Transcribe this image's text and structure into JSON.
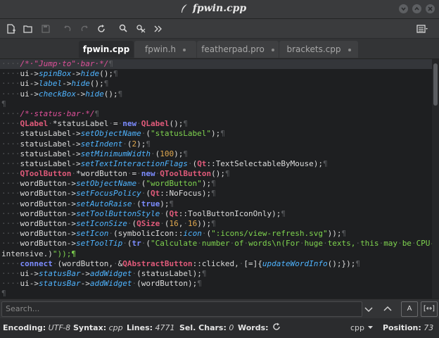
{
  "window": {
    "title": "fpwin.cpp",
    "buttons": [
      "minimize",
      "maximize",
      "close"
    ]
  },
  "toolbar": {
    "items": [
      "new-file-icon",
      "open-folder-icon",
      "save-icon",
      "undo-icon",
      "redo-icon",
      "reload-icon",
      "find-icon",
      "find-replace-icon",
      "go-to-line-icon",
      "menu-icon"
    ]
  },
  "tabs": [
    {
      "label": "fpwin.cpp",
      "active": true
    },
    {
      "label": "fpwin.h",
      "active": false
    },
    {
      "label": "featherpad.pro",
      "active": false
    },
    {
      "label": "brackets.cpp",
      "active": false
    }
  ],
  "editor": {
    "lines": [
      "····/*·\"Jump·to\"·bar·*/¶",
      "····ui->spinBox->hide();¶",
      "····ui->label->hide();¶",
      "····ui->checkBox->hide();¶",
      "¶",
      "····/*·status·bar·*/¶",
      "····QLabel·*statusLabel·=·new·QLabel();¶",
      "····statusLabel->setObjectName·(\"statusLabel\");¶",
      "····statusLabel->setIndent·(2);¶",
      "····statusLabel->setMinimumWidth·(100);¶",
      "····statusLabel->setTextInteractionFlags·(Qt::TextSelectableByMouse);¶",
      "····QToolButton·*wordButton·=·new·QToolButton();¶",
      "····wordButton->setObjectName·(\"wordButton\");¶",
      "····wordButton->setFocusPolicy·(Qt::NoFocus);¶",
      "····wordButton->setAutoRaise·(true);¶",
      "····wordButton->setToolButtonStyle·(Qt::ToolButtonIconOnly);¶",
      "····wordButton->setIconSize·(QSize·(16,·16));¶",
      "····wordButton->setIcon·(symbolicIcon::icon·(\":icons/view-refresh.svg\"));¶",
      "····wordButton->setToolTip·(tr·(\"Calculate·number·of·words\\n(For·huge·texts,·this·may·be·CPU-",
      "intensive.)\"));¶",
      "····connect·(wordButton,·&QAbstractButton::clicked,·[=]{updateWordInfo();});¶",
      "····ui->statusBar->addWidget·(statusLabel);¶",
      "····ui->statusBar->addWidget·(wordButton);¶",
      "¶"
    ]
  },
  "search": {
    "placeholder": "Search...",
    "match_case_label": "A",
    "whole_word_label": "[↔]"
  },
  "status": {
    "encoding_label": "Encoding:",
    "encoding_value": "UTF-8",
    "syntax_label": "Syntax:",
    "syntax_value": "cpp",
    "lines_label": "Lines:",
    "lines_value": "4771",
    "selchars_label": "Sel. Chars:",
    "selchars_value": "0",
    "words_label": "Words:",
    "lang_value": "cpp",
    "position_label": "Position:",
    "position_value": "73"
  },
  "colors": {
    "comment": "#e0509a",
    "function": "#4fb4ff",
    "keyword": "#7c8cff",
    "type": "#e05a7a",
    "string": "#7fd44f",
    "number": "#e0a84f"
  }
}
